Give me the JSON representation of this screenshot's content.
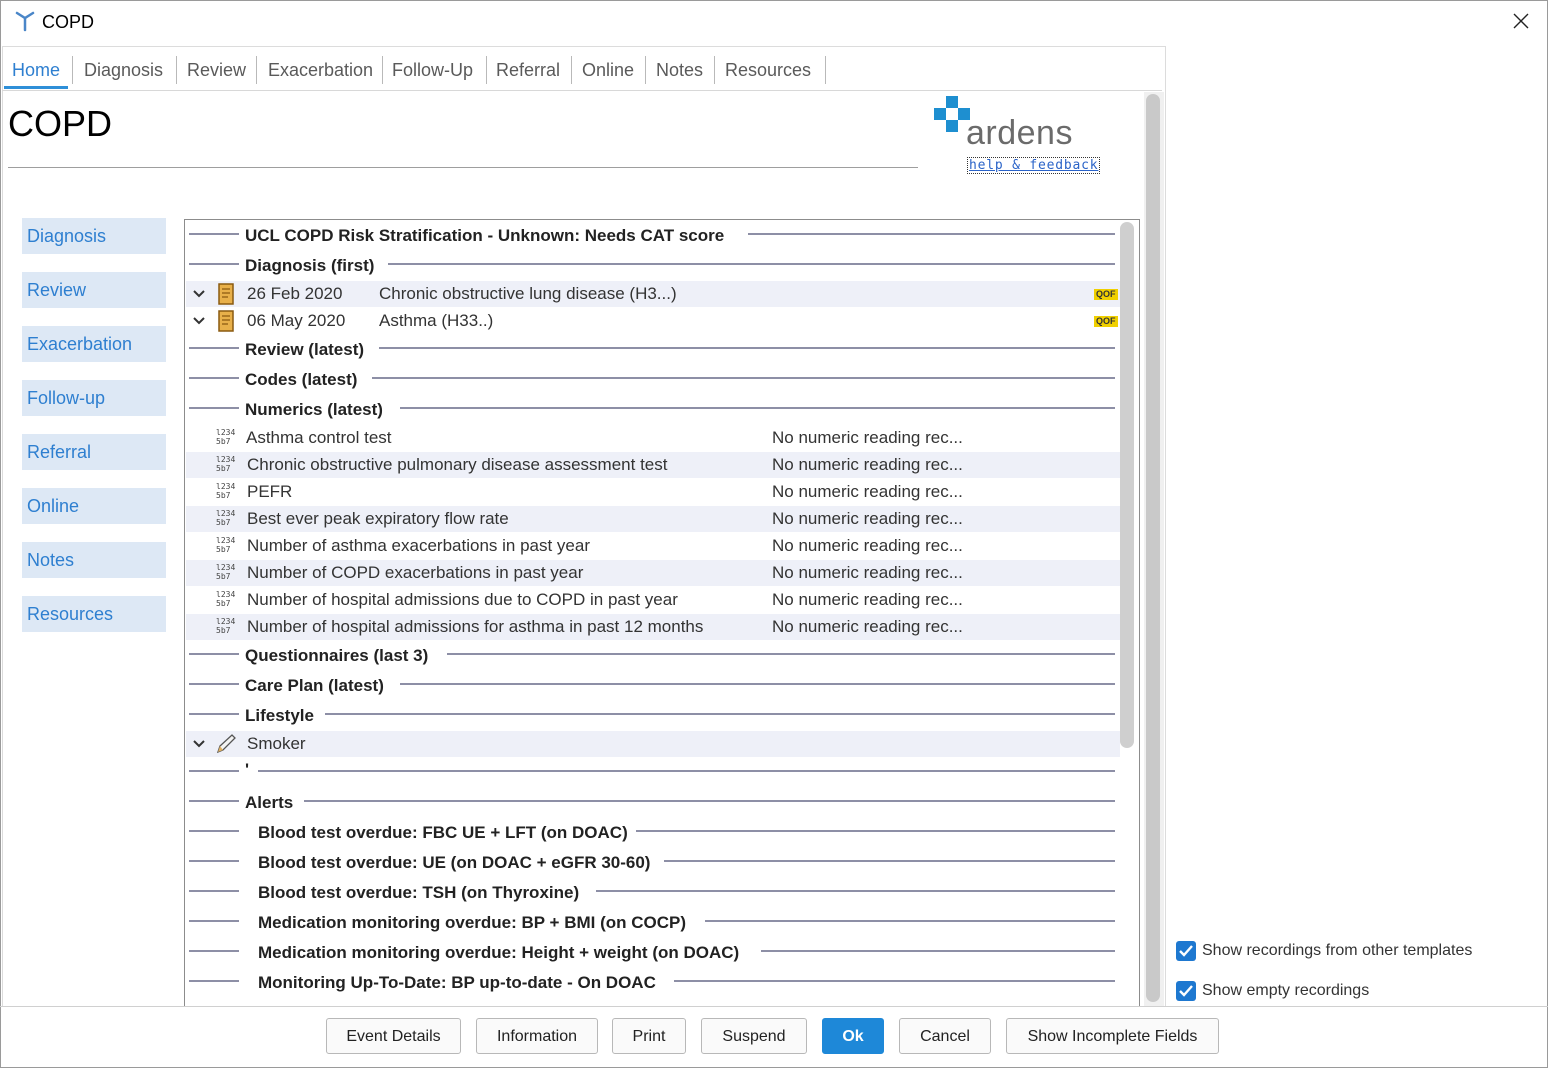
{
  "window": {
    "title": "COPD",
    "close_glyph": "✕"
  },
  "tabs": [
    {
      "label": "Home",
      "active": true
    },
    {
      "label": "Diagnosis"
    },
    {
      "label": "Review"
    },
    {
      "label": "Exacerbation"
    },
    {
      "label": "Follow-Up"
    },
    {
      "label": "Referral"
    },
    {
      "label": "Online"
    },
    {
      "label": "Notes"
    },
    {
      "label": "Resources"
    }
  ],
  "page_title": "COPD",
  "logo": {
    "text": "ardens",
    "help_link": "help & feedback",
    "brand_color": "#1e8fd0"
  },
  "sidebar": [
    {
      "label": "Diagnosis"
    },
    {
      "label": "Review"
    },
    {
      "label": "Exacerbation"
    },
    {
      "label": "Follow-up"
    },
    {
      "label": "Referral"
    },
    {
      "label": "Online"
    },
    {
      "label": "Notes"
    },
    {
      "label": "Resources"
    }
  ],
  "sections": {
    "ucl": "UCL COPD Risk Stratification - Unknown: Needs CAT score",
    "diagnosis": "Diagnosis (first)",
    "review": "Review (latest)",
    "codes": "Codes (latest)",
    "numerics": "Numerics (latest)",
    "questionnaires": "Questionnaires (last 3)",
    "careplan": "Care Plan (latest)",
    "lifestyle": "Lifestyle",
    "dot": "'",
    "alerts": "Alerts"
  },
  "diagnoses": [
    {
      "date": "26 Feb 2020",
      "text": "Chronic obstructive lung disease (H3...)",
      "badge": "QOF"
    },
    {
      "date": "06 May 2020",
      "text": "Asthma (H33..)",
      "badge": "QOF"
    }
  ],
  "numerics": [
    {
      "icon": "numeric-icon",
      "name": "Asthma control test",
      "value": "No numeric reading rec..."
    },
    {
      "icon": "numeric-icon",
      "name": "Chronic obstructive pulmonary disease assessment test",
      "value": "No numeric reading rec..."
    },
    {
      "icon": "numeric-icon",
      "name": "PEFR",
      "value": "No numeric reading rec..."
    },
    {
      "icon": "numeric-icon",
      "name": "Best ever peak expiratory flow rate",
      "value": "No numeric reading rec..."
    },
    {
      "icon": "numeric-icon",
      "name": "Number of asthma exacerbations in past year",
      "value": "No numeric reading rec..."
    },
    {
      "icon": "numeric-icon",
      "name": "Number of COPD exacerbations in past year",
      "value": "No numeric reading rec..."
    },
    {
      "icon": "numeric-icon",
      "name": "Number of hospital admissions due to COPD in past year",
      "value": "No numeric reading rec..."
    },
    {
      "icon": "numeric-icon",
      "name": "Number of hospital admissions for asthma in past 12 months",
      "value": "No numeric reading rec..."
    }
  ],
  "lifestyle": [
    {
      "icon": "pencil-icon",
      "label": "Smoker"
    }
  ],
  "alerts": [
    "Blood test overdue: FBC UE + LFT (on DOAC)",
    "Blood test overdue: UE (on DOAC + eGFR 30-60)",
    "Blood test overdue: TSH (on Thyroxine)",
    "Medication monitoring overdue: BP + BMI (on COCP)",
    "Medication monitoring overdue: Height + weight (on DOAC)",
    "Monitoring Up-To-Date: BP up-to-date - On DOAC"
  ],
  "options": [
    {
      "label": "Show recordings from other templates",
      "checked": true
    },
    {
      "label": "Show empty recordings",
      "checked": true
    }
  ],
  "buttons": {
    "event_details": "Event Details",
    "information": "Information",
    "print": "Print",
    "suspend": "Suspend",
    "ok": "Ok",
    "cancel": "Cancel",
    "show_incomplete": "Show Incomplete Fields"
  }
}
